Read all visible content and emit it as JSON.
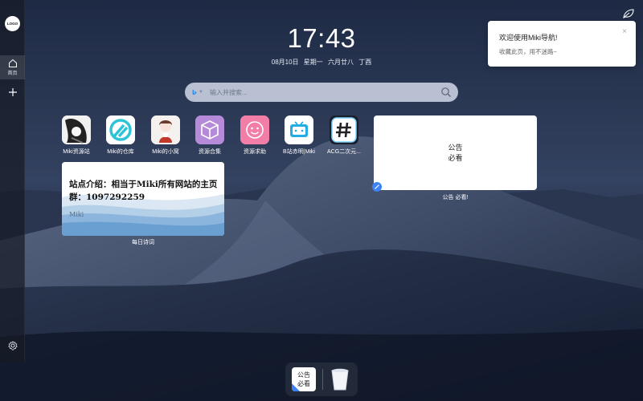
{
  "sidebar": {
    "logo_text": "LOGO",
    "home_label": "首页"
  },
  "clock": {
    "time": "17:43",
    "date": "08月10日",
    "weekday": "星期一",
    "lunar": "六月廿八",
    "ganzhi": "丁酉"
  },
  "search": {
    "placeholder": "输入并搜索...",
    "value": ""
  },
  "apps": [
    {
      "label": "Miki资源站",
      "icon": "manga-avatar-icon"
    },
    {
      "label": "Miki的仓库",
      "icon": "repo-logo-icon"
    },
    {
      "label": "Miki的小窝",
      "icon": "anime-girl-icon"
    },
    {
      "label": "资源合集",
      "icon": "package-box-icon"
    },
    {
      "label": "资源求助",
      "icon": "smiley-face-icon"
    },
    {
      "label": "B站赤明|Miki",
      "icon": "bilibili-icon"
    },
    {
      "label": "ACG二次元...",
      "icon": "hashtag-icon"
    }
  ],
  "poem": {
    "text": "站点介绍：相当于Miki所有网站的主页  群：1097292259",
    "author": "Miki",
    "caption": "每日诗词"
  },
  "notice_widget": {
    "line1": "公告",
    "line2": "必看",
    "caption": "公告 必看!"
  },
  "toast": {
    "title": "欢迎使用Miki导航!",
    "body": "收藏此页，用不迷路~"
  },
  "dock": {
    "notice_line1": "公告",
    "notice_line2": "必看"
  },
  "colors": {
    "accent": "#3b82f6",
    "sky": "#1f2b45",
    "dune": "#3a4660"
  }
}
